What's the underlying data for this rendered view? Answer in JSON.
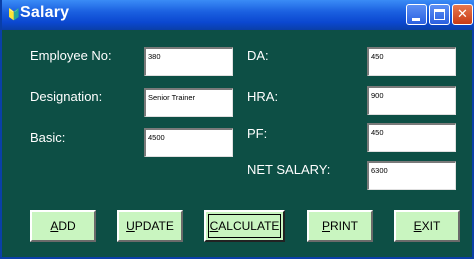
{
  "window": {
    "title": "Salary",
    "minimize_label": "",
    "maximize_label": "",
    "close_label": "✕",
    "icon": "app-icon"
  },
  "left_fields": [
    {
      "label": "Employee No:",
      "value": "380"
    },
    {
      "label": "Designation:",
      "value": "Senior Trainer"
    },
    {
      "label": "Basic:",
      "value": "4500"
    }
  ],
  "right_fields": [
    {
      "label": "DA:",
      "value": "450"
    },
    {
      "label": "HRA:",
      "value": "900"
    },
    {
      "label": "PF:",
      "value": "450"
    },
    {
      "label": "NET SALARY:",
      "value": "6300"
    }
  ],
  "buttons": [
    {
      "accel": "A",
      "rest": "DD"
    },
    {
      "accel": "U",
      "rest": "PDATE"
    },
    {
      "accel": "C",
      "rest": "ALCULATE"
    },
    {
      "accel": "P",
      "rest": "RINT"
    },
    {
      "accel": "E",
      "rest": "XIT"
    }
  ],
  "colors": {
    "background": "#0d4f45",
    "button": "#c9f5c0",
    "titlebar": "#0b47d0"
  }
}
